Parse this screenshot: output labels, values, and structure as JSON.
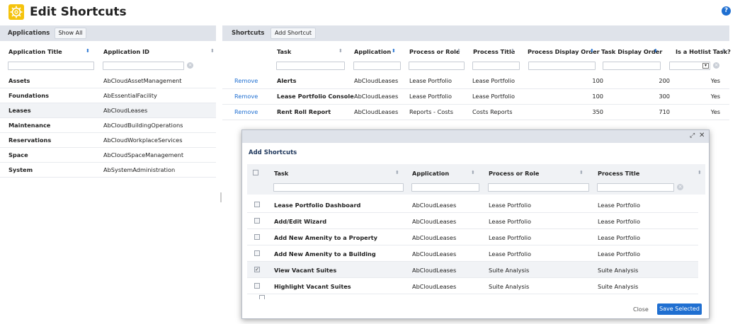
{
  "page": {
    "title": "Edit Shortcuts",
    "help": "?"
  },
  "left": {
    "bar_label": "Applications",
    "show_all": "Show All",
    "col_title": "Application Title",
    "col_id": "Application ID",
    "rows": [
      {
        "title": "Assets",
        "id": "AbCloudAssetManagement"
      },
      {
        "title": "Foundations",
        "id": "AbEssentialFacility"
      },
      {
        "title": "Leases",
        "id": "AbCloudLeases"
      },
      {
        "title": "Maintenance",
        "id": "AbCloudBuildingOperations"
      },
      {
        "title": "Reservations",
        "id": "AbCloudWorkplaceServices"
      },
      {
        "title": "Space",
        "id": "AbCloudSpaceManagement"
      },
      {
        "title": "System",
        "id": "AbSystemAdministration"
      }
    ]
  },
  "right": {
    "bar_label": "Shortcuts",
    "add_button": "Add Shortcut",
    "cols": [
      "Task",
      "Application",
      "Process or Role",
      "Process Title",
      "Process Display Order",
      "Task Display Order",
      "Is a Hotlist Task?"
    ],
    "remove_label": "Remove",
    "rows": [
      {
        "task": "Alerts",
        "app": "AbCloudLeases",
        "role": "Lease Portfolio",
        "ptitle": "Lease Portfolio",
        "porder": "100",
        "torder": "200",
        "hot": "Yes"
      },
      {
        "task": "Lease Portfolio Console",
        "app": "AbCloudLeases",
        "role": "Lease Portfolio",
        "ptitle": "Lease Portfolio",
        "porder": "100",
        "torder": "300",
        "hot": "Yes"
      },
      {
        "task": "Rent Roll Report",
        "app": "AbCloudLeases",
        "role": "Reports - Costs",
        "ptitle": "Costs Reports",
        "porder": "350",
        "torder": "710",
        "hot": "Yes"
      }
    ]
  },
  "dialog": {
    "title": "Add Shortcuts",
    "cols": [
      "Task",
      "Application",
      "Process or Role",
      "Process Title"
    ],
    "rows": [
      {
        "task": "Lease Portfolio Dashboard",
        "app": "AbCloudLeases",
        "role": "Lease Portfolio",
        "ptitle": "Lease Portfolio",
        "checked": false
      },
      {
        "task": "Add/Edit Wizard",
        "app": "AbCloudLeases",
        "role": "Lease Portfolio",
        "ptitle": "Lease Portfolio",
        "checked": false
      },
      {
        "task": "Add New Amenity to a Property",
        "app": "AbCloudLeases",
        "role": "Lease Portfolio",
        "ptitle": "Lease Portfolio",
        "checked": false
      },
      {
        "task": "Add New Amenity to a Building",
        "app": "AbCloudLeases",
        "role": "Lease Portfolio",
        "ptitle": "Lease Portfolio",
        "checked": false
      },
      {
        "task": "View Vacant Suites",
        "app": "AbCloudLeases",
        "role": "Suite Analysis",
        "ptitle": "Suite Analysis",
        "checked": true
      },
      {
        "task": "Highlight Vacant Suites",
        "app": "AbCloudLeases",
        "role": "Suite Analysis",
        "ptitle": "Suite Analysis",
        "checked": false
      }
    ],
    "close_label": "Close",
    "save_label": "Save Selected",
    "check_glyph": "✓"
  },
  "colors": {
    "accent": "#1f6fd1",
    "toolbar": "#dfe3ea",
    "app_icon": "#f5c30c"
  }
}
